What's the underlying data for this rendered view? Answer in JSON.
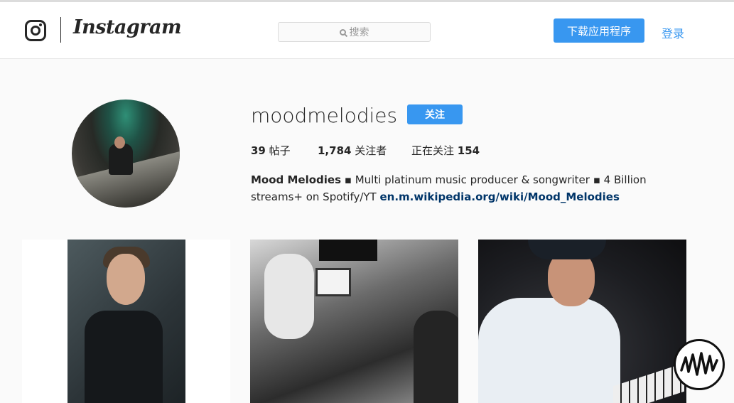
{
  "nav": {
    "brand": "Instagram",
    "search_placeholder": "搜索",
    "download_label": "下载应用程序",
    "login_label": "登录"
  },
  "profile": {
    "username": "moodmelodies",
    "follow_label": "关注",
    "stats": {
      "posts_count": "39",
      "posts_label": "帖子",
      "followers_count": "1,784",
      "followers_label": "关注者",
      "following_label": "正在关注",
      "following_count": "154"
    },
    "bio": {
      "name": "Mood Melodies",
      "text": " ▪ Multi platinum music producer & songwriter ▪ 4 Billion streams+ on Spotify/YT ",
      "link": "en.m.wikipedia.org/wiki/Mood_Melodies"
    }
  },
  "posts": [
    "portrait in black t-shirt",
    "studio session black and white",
    "producer at keyboard"
  ],
  "colors": {
    "accent": "#3897f0",
    "link": "#003569",
    "background": "#fafafa"
  },
  "icons": [
    "instagram-camera-icon",
    "search-icon",
    "watermark-logo-icon"
  ]
}
